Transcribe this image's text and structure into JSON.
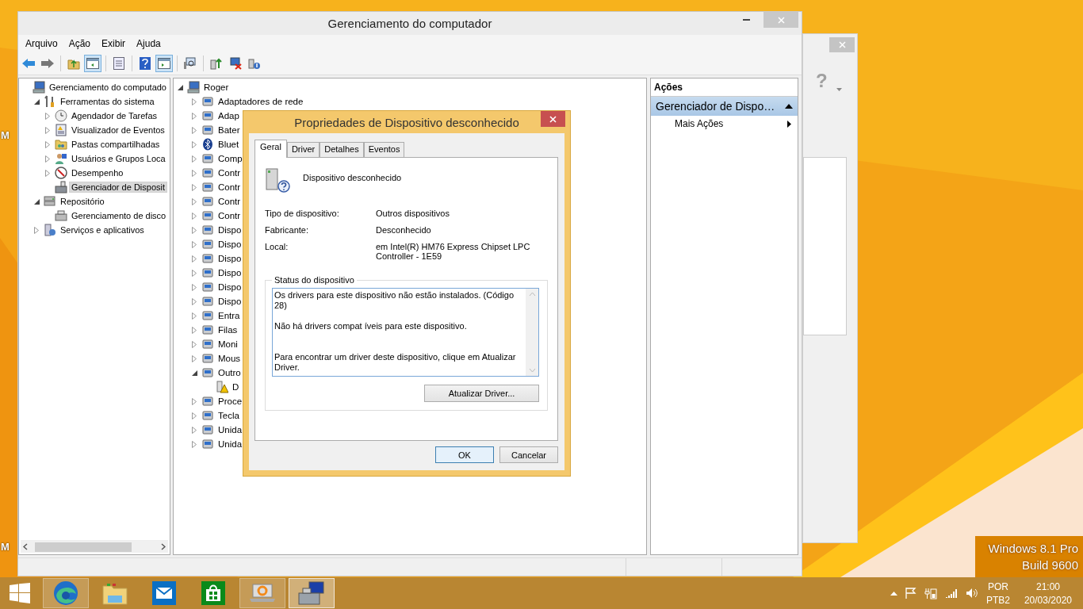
{
  "desktop": {
    "edge_labels": [
      "M",
      "M"
    ],
    "watermark": [
      "Windows 8.1 Pro",
      "Build 9600"
    ]
  },
  "background_window": {
    "help": "?"
  },
  "main_window": {
    "title": "Gerenciamento do computador",
    "menu": [
      "Arquivo",
      "Ação",
      "Exibir",
      "Ajuda"
    ],
    "toolbar": [
      {
        "pressed": false
      },
      {
        "pressed": false
      },
      {
        "pressed": false
      },
      {
        "pressed": true
      },
      {
        "pressed": false
      },
      {
        "pressed": false
      },
      {
        "pressed": true
      },
      {
        "pressed": false
      },
      {
        "pressed": false
      },
      {
        "pressed": false
      },
      {
        "pressed": false
      }
    ],
    "nav_tree": [
      {
        "label": "Gerenciamento do computado",
        "selected": false,
        "children": [
          {
            "label": "Ferramentas do sistema",
            "selected": false,
            "expanded": true,
            "children": [
              {
                "label": "Agendador de Tarefas",
                "selected": false,
                "expanded": false
              },
              {
                "label": "Visualizador de Eventos",
                "selected": false,
                "expanded": false
              },
              {
                "label": "Pastas compartilhadas",
                "selected": false,
                "expanded": false
              },
              {
                "label": "Usuários e Grupos Loca",
                "selected": false,
                "expanded": false
              },
              {
                "label": "Desempenho",
                "selected": false,
                "expanded": false
              },
              {
                "label": "Gerenciador de Disposit",
                "selected": true
              }
            ]
          },
          {
            "label": "Repositório",
            "selected": false,
            "expanded": true,
            "children": [
              {
                "label": "Gerenciamento de disco",
                "selected": false
              }
            ]
          },
          {
            "label": "Serviços e aplicativos",
            "selected": false,
            "expanded": false
          }
        ]
      }
    ],
    "device_tree": [
      {
        "label": "Roger",
        "expanded": true,
        "children": [
          {
            "label": "Adaptadores de rede",
            "expanded": false
          },
          {
            "label": "Adap",
            "expanded": false
          },
          {
            "label": "Bater",
            "expanded": false
          },
          {
            "label": "Bluet",
            "expanded": false
          },
          {
            "label": "Comp",
            "expanded": false
          },
          {
            "label": "Contr",
            "expanded": false
          },
          {
            "label": "Contr",
            "expanded": false
          },
          {
            "label": "Contr",
            "expanded": false
          },
          {
            "label": "Contr",
            "expanded": false
          },
          {
            "label": "Dispo",
            "expanded": false
          },
          {
            "label": "Dispo",
            "expanded": false
          },
          {
            "label": "Dispo",
            "expanded": false
          },
          {
            "label": "Dispo",
            "expanded": false
          },
          {
            "label": "Dispo",
            "expanded": false
          },
          {
            "label": "Dispo",
            "expanded": false
          },
          {
            "label": "Entra",
            "expanded": false
          },
          {
            "label": "Filas",
            "expanded": false
          },
          {
            "label": "Moni",
            "expanded": false
          },
          {
            "label": "Mous",
            "expanded": false
          },
          {
            "label": "Outro",
            "expanded": true,
            "children": [
              {
                "label": "D"
              }
            ]
          },
          {
            "label": "Proce",
            "expanded": false
          },
          {
            "label": "Tecla",
            "expanded": false
          },
          {
            "label": "Unida",
            "expanded": false
          },
          {
            "label": "Unida",
            "expanded": false
          }
        ]
      }
    ],
    "actions": {
      "title": "Ações",
      "group": "Gerenciador de Dispo…",
      "expanded": true,
      "items": [
        "Mais Ações"
      ]
    }
  },
  "dialog": {
    "title": "Propriedades de Dispositivo desconhecido",
    "tabs": [
      {
        "label": "Geral",
        "selected": true
      },
      {
        "label": "Driver",
        "selected": false
      },
      {
        "label": "Detalhes",
        "selected": false
      },
      {
        "label": "Eventos",
        "selected": false
      }
    ],
    "device_name": "Dispositivo desconhecido",
    "properties": [
      {
        "label": "Tipo de dispositivo:",
        "value": "Outros dispositivos"
      },
      {
        "label": "Fabricante:",
        "value": "Desconhecido"
      },
      {
        "label": "Local:",
        "value": "em Intel(R) HM76 Express Chipset LPC Controller - 1E59"
      }
    ],
    "status_group": "Status do dispositivo",
    "status_text": "Os drivers para este dispositivo não estão instalados. (Código 28)\n\nNão há drivers compat íveis para este dispositivo.\n\n\nPara encontrar um driver deste dispositivo, clique em Atualizar Driver.",
    "update_button": "Atualizar Driver...",
    "buttons": [
      "OK",
      "Cancelar"
    ]
  },
  "taskbar": {
    "apps": [
      {
        "running": true,
        "selected": false
      },
      {
        "running": false,
        "selected": false
      },
      {
        "running": false,
        "selected": false
      },
      {
        "running": false,
        "selected": false
      },
      {
        "running": true,
        "selected": false
      },
      {
        "running": true,
        "selected": true
      }
    ],
    "language": "POR",
    "keyboard": "PTB2",
    "time": "21:00",
    "date": "20/03/2020"
  }
}
